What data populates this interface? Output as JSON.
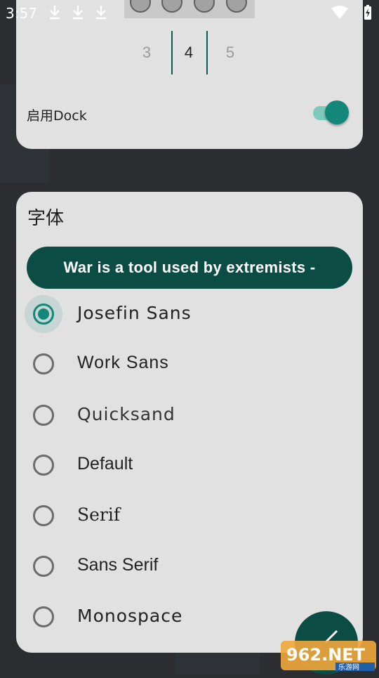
{
  "status_bar": {
    "time": "3:57",
    "download_icons": [
      "download-icon",
      "download-icon",
      "download-icon"
    ],
    "wifi_icon": "wifi-icon",
    "battery_icon": "battery-charging-icon"
  },
  "dock_card": {
    "columns_picker": {
      "options": [
        "3",
        "4",
        "5"
      ],
      "selected": "4"
    },
    "enable_dock_label": "启用Dock",
    "enable_dock_on": true
  },
  "font_card": {
    "title": "字体",
    "preview_text": "War is a tool used by extremists -",
    "options": [
      {
        "label": "Josefin Sans",
        "checked": true
      },
      {
        "label": "Work Sans",
        "checked": false
      },
      {
        "label": "Quicksand",
        "checked": false
      },
      {
        "label": "Default",
        "checked": false
      },
      {
        "label": "Serif",
        "checked": false
      },
      {
        "label": "Sans Serif",
        "checked": false
      },
      {
        "label": "Monospace",
        "checked": false
      }
    ]
  },
  "fab": {
    "icon": "pencil-icon"
  },
  "watermark": {
    "text": "962.NET",
    "subtext": "乐游网"
  },
  "colors": {
    "accent": "#12877a",
    "accent_dark": "#0b4d45",
    "card": "#e1e1e1",
    "background": "#2b2d31"
  }
}
